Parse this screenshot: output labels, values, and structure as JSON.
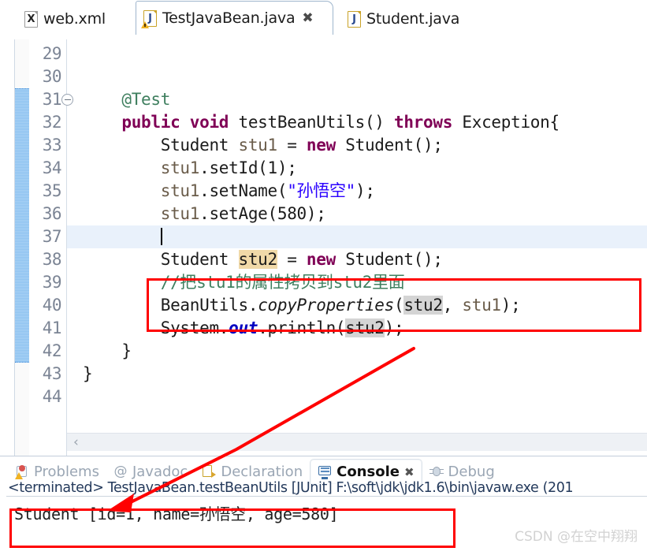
{
  "editor_tabs": [
    {
      "label": "web.xml",
      "icon": "xml-file-icon",
      "glyph": "X",
      "active": false,
      "warning": false,
      "closeable": false
    },
    {
      "label": "TestJavaBean.java",
      "icon": "java-file-icon",
      "glyph": "J",
      "active": true,
      "warning": true,
      "closeable": true,
      "close_glyph": "✖"
    },
    {
      "label": "Student.java",
      "icon": "java-file-icon",
      "glyph": "J",
      "active": false,
      "warning": false,
      "closeable": false
    }
  ],
  "editor": {
    "first_line": 29,
    "last_line": 44,
    "current_line": 37,
    "fold_line": 31,
    "marker_range": "31-42",
    "scroll_left_glyph": "‹",
    "lines": [
      {
        "n": 29,
        "segments": []
      },
      {
        "n": 30,
        "segments": []
      },
      {
        "n": 31,
        "fold": true,
        "segments": [
          {
            "t": "    @Test",
            "c": "cmt"
          }
        ]
      },
      {
        "n": 32,
        "segments": [
          {
            "t": "    "
          },
          {
            "t": "public void ",
            "c": "kw"
          },
          {
            "t": "testBeanUtils() "
          },
          {
            "t": "throws ",
            "c": "kw"
          },
          {
            "t": "Exception{"
          }
        ]
      },
      {
        "n": 33,
        "segments": [
          {
            "t": "        Student "
          },
          {
            "t": "stu1",
            "c": "var"
          },
          {
            "t": " = "
          },
          {
            "t": "new ",
            "c": "kw"
          },
          {
            "t": "Student();"
          }
        ]
      },
      {
        "n": 34,
        "segments": [
          {
            "t": "        "
          },
          {
            "t": "stu1",
            "c": "var"
          },
          {
            "t": ".setId(1);"
          }
        ]
      },
      {
        "n": 35,
        "segments": [
          {
            "t": "        "
          },
          {
            "t": "stu1",
            "c": "var"
          },
          {
            "t": ".setName("
          },
          {
            "t": "\"孙悟空\"",
            "c": "str"
          },
          {
            "t": ");"
          }
        ]
      },
      {
        "n": 36,
        "segments": [
          {
            "t": "        "
          },
          {
            "t": "stu1",
            "c": "var"
          },
          {
            "t": ".setAge(580);"
          }
        ]
      },
      {
        "n": 37,
        "segments": [],
        "caret": true,
        "highlight": true
      },
      {
        "n": 38,
        "segments": [
          {
            "t": "        Student "
          },
          {
            "t": "stu2",
            "c": "wsel"
          },
          {
            "t": " = "
          },
          {
            "t": "new ",
            "c": "kw"
          },
          {
            "t": "Student();"
          }
        ]
      },
      {
        "n": 39,
        "segments": [
          {
            "t": "        //把stu1的属性拷贝到stu2里面",
            "c": "cmt"
          }
        ]
      },
      {
        "n": 40,
        "segments": [
          {
            "t": "        BeanUtils."
          },
          {
            "t": "copyProperties",
            "c": "mtd"
          },
          {
            "t": "("
          },
          {
            "t": "stu2",
            "c": "occ"
          },
          {
            "t": ", "
          },
          {
            "t": "stu1",
            "c": "var"
          },
          {
            "t": ");"
          }
        ]
      },
      {
        "n": 41,
        "segments": [
          {
            "t": "        System."
          },
          {
            "t": "out",
            "c": "fld"
          },
          {
            "t": ".println("
          },
          {
            "t": "stu2",
            "c": "occ"
          },
          {
            "t": ");"
          }
        ]
      },
      {
        "n": 42,
        "segments": [
          {
            "t": "    }"
          }
        ]
      },
      {
        "n": 43,
        "segments": [
          {
            "t": "}"
          }
        ]
      },
      {
        "n": 44,
        "segments": []
      }
    ]
  },
  "bottom_tabs": [
    {
      "label": "Problems",
      "icon": "problems-icon",
      "active": false,
      "closeable": false
    },
    {
      "label": "Javadoc",
      "icon": "javadoc-icon",
      "active": false,
      "closeable": false
    },
    {
      "label": "Declaration",
      "icon": "declaration-icon",
      "active": false,
      "closeable": false
    },
    {
      "label": "Console",
      "icon": "console-icon",
      "active": true,
      "closeable": true,
      "close_glyph": "✖"
    },
    {
      "label": "Debug",
      "icon": "debug-icon",
      "active": false,
      "closeable": false
    }
  ],
  "console": {
    "terminated_line": "<terminated> TestJavaBean.testBeanUtils [JUnit] F:\\soft\\jdk\\jdk1.6\\bin\\javaw.exe (201",
    "output": "Student [id=1, name=孙悟空, age=580]"
  },
  "watermark": "CSDN @在空中翔翔",
  "annotations": {
    "accent_color": "#ff0000",
    "code_box_label": "red-box-around-copyProperties",
    "console_box_label": "red-box-around-console-output",
    "arrow_label": "arrow-from-stu2-to-console-output"
  }
}
